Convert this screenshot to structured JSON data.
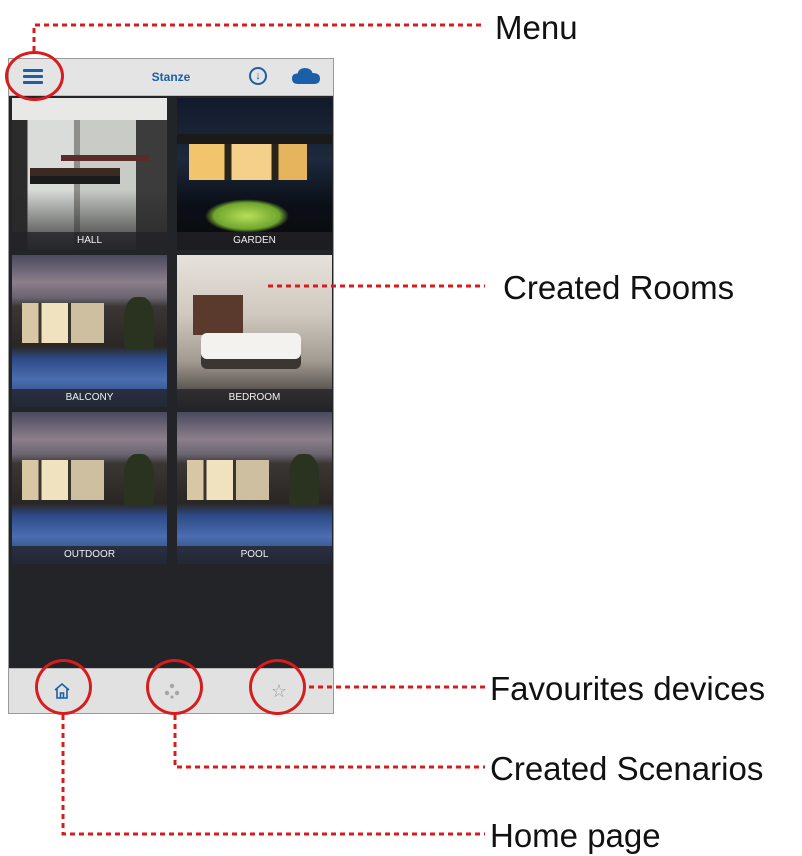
{
  "app": {
    "title": "Stanze",
    "icons": {
      "menu": "hamburger-menu-icon",
      "download": "download-circle-icon",
      "cloud": "cloud-icon"
    }
  },
  "rooms": [
    {
      "label": "HALL",
      "scene": "hall"
    },
    {
      "label": "GARDEN",
      "scene": "garden"
    },
    {
      "label": "BALCONY",
      "scene": "pool"
    },
    {
      "label": "BEDROOM",
      "scene": "bed"
    },
    {
      "label": "OUTDOOR",
      "scene": "pool"
    },
    {
      "label": "POOL",
      "scene": "pool"
    }
  ],
  "tabs": [
    {
      "icon": "home-icon"
    },
    {
      "icon": "scenarios-icon"
    },
    {
      "icon": "star-icon",
      "glyph": "☆"
    }
  ],
  "annotations": {
    "menu": "Menu",
    "rooms": "Created Rooms",
    "favourites": "Favourites devices",
    "scenarios": "Created Scenarios",
    "home": "Home page"
  },
  "colors": {
    "annotation_red": "#d81c1c",
    "accent_blue": "#1a5fa8",
    "app_background": "#232427"
  }
}
